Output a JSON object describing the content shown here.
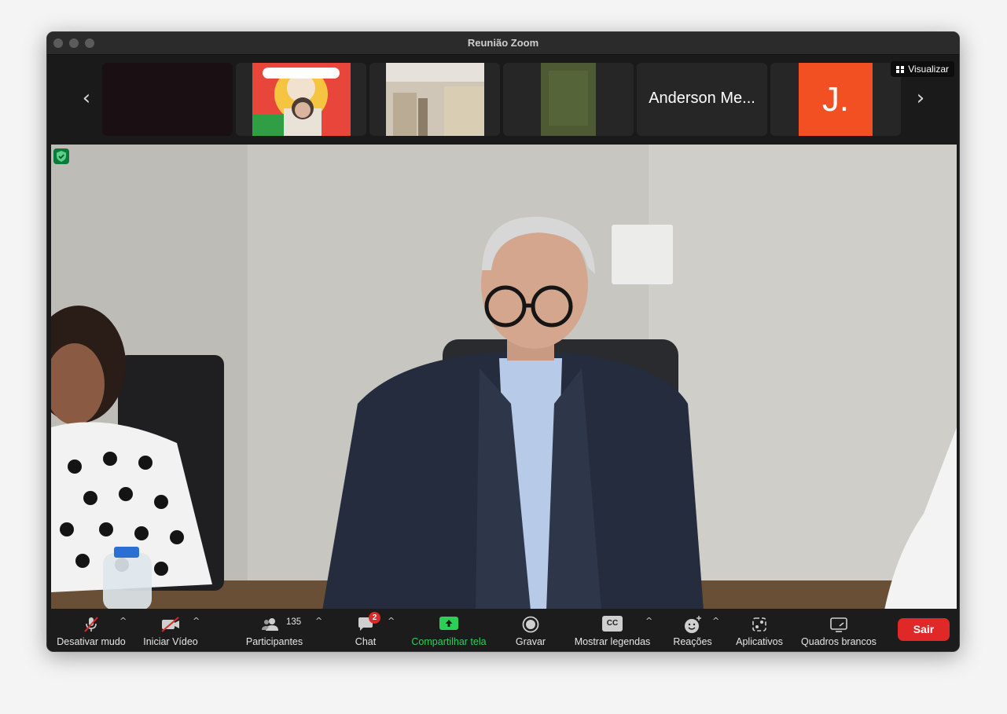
{
  "window": {
    "title": "Reunião Zoom"
  },
  "gallery": {
    "prev_icon": "chevron-left-icon",
    "next_icon": "chevron-right-icon",
    "view_button_label": "Visualizar",
    "tiles": [
      {
        "type": "video-dark"
      },
      {
        "type": "video-poster"
      },
      {
        "type": "video-room"
      },
      {
        "type": "video-blurred"
      },
      {
        "type": "name",
        "name": "Anderson Me..."
      },
      {
        "type": "avatar",
        "initial": "J.",
        "color": "#f25022"
      }
    ]
  },
  "main_video": {
    "security_icon": "shield-check-icon",
    "security_color": "#0b7a3a"
  },
  "toolbar": {
    "mute_label": "Desativar mudo",
    "video_label": "Iniciar Vídeo",
    "participants_label": "Participantes",
    "participants_count": "135",
    "chat_label": "Chat",
    "chat_badge": "2",
    "share_label": "Compartilhar tela",
    "record_label": "Gravar",
    "captions_label": "Mostrar legendas",
    "captions_icon_text": "CC",
    "reactions_label": "Reações",
    "apps_label": "Aplicativos",
    "whiteboards_label": "Quadros brancos",
    "leave_label": "Sair",
    "share_color": "#2bd157",
    "leave_color": "#e02828"
  }
}
